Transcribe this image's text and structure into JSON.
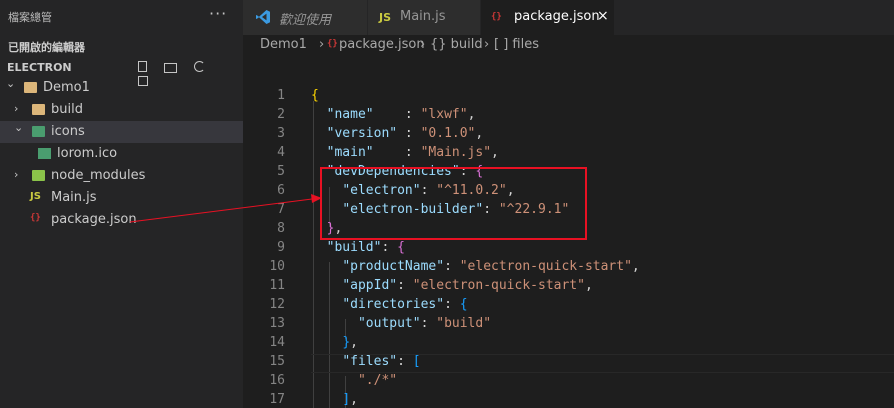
{
  "sidebar": {
    "title": "檔案總管",
    "more": "···",
    "opened_editors": "已開啟的編輯器",
    "project": "ELECTRON",
    "tree": [
      {
        "label": "Demo1",
        "depth": 0,
        "kind": "folder",
        "open": true
      },
      {
        "label": "build",
        "depth": 1,
        "kind": "folder",
        "open": false
      },
      {
        "label": "icons",
        "depth": 1,
        "kind": "folder",
        "open": true,
        "selected": true
      },
      {
        "label": "lorom.ico",
        "depth": 2,
        "kind": "image"
      },
      {
        "label": "node_modules",
        "depth": 1,
        "kind": "folder",
        "open": false
      },
      {
        "label": "Main.js",
        "depth": 1,
        "kind": "js"
      },
      {
        "label": "package.json",
        "depth": 1,
        "kind": "json"
      }
    ]
  },
  "tabs": [
    {
      "label": "歡迎使用",
      "icon": "vscode-icon",
      "active": false
    },
    {
      "label": "Main.js",
      "icon": "js-icon",
      "active": false
    },
    {
      "label": "package.json",
      "icon": "json-icon",
      "active": true,
      "close": "×"
    }
  ],
  "breadcrumb": [
    "Demo1",
    "package.json",
    "{} build",
    "[ ] files"
  ],
  "breadcrumb_separator": "›",
  "icons": {
    "js": "JS",
    "json": "{}"
  },
  "editor": {
    "line_numbers": [
      "1",
      "2",
      "3",
      "4",
      "5",
      "6",
      "7",
      "8",
      "9",
      "10",
      "11",
      "12",
      "13",
      "14",
      "15",
      "16",
      "17"
    ],
    "lines": [
      "{",
      "  \"name\"    : \"lxwf\",",
      "  \"version\" : \"0.1.0\",",
      "  \"main\"    : \"Main.js\",",
      "  \"devDependencies\": {",
      "    \"electron\": \"^11.0.2\",",
      "    \"electron-builder\": \"^22.9.1\"",
      "  },",
      "  \"build\": {",
      "    \"productName\": \"electron-quick-start\",",
      "    \"appId\": \"electron-quick-start\",",
      "    \"directories\": {",
      "      \"output\": \"build\"",
      "    },",
      "    \"files\": [",
      "      \"./*\"",
      "    ],"
    ]
  },
  "colors": {
    "annotation": "#e81123",
    "string": "#ce9178",
    "key": "#9cdcfe"
  }
}
